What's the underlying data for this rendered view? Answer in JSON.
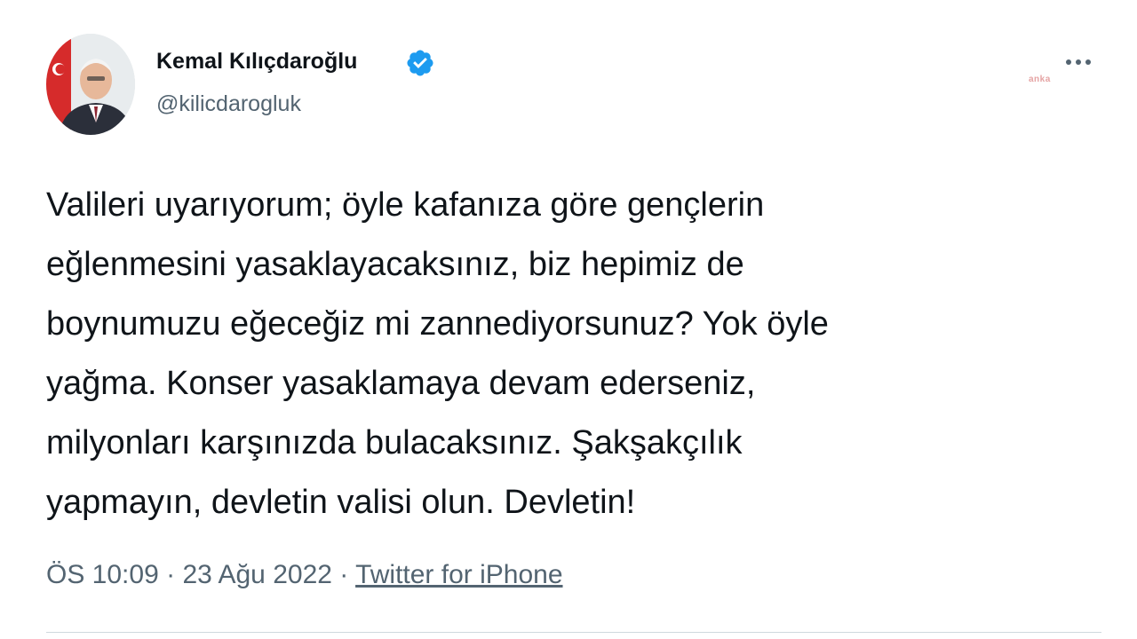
{
  "author": {
    "name": "Kemal Kılıçdaroğlu",
    "handle": "@kilicdarogluk",
    "verified": true,
    "avatar_icon": "profile-photo"
  },
  "watermark": "anka",
  "tweet": {
    "lines": [
      "Valileri uyarıyorum; öyle kafanıza göre gençlerin",
      "eğlenmesini yasaklayacaksınız, biz hepimiz de",
      "boynumuzu eğeceğiz mi zannediyorsunuz? Yok öyle",
      "yağma. Konser yasaklamaya devam ederseniz,",
      "milyonları karşınızda bulacaksınız. Şakşakçılık",
      "yapmayın, devletin valisi olun. Devletin!"
    ]
  },
  "meta": {
    "time": "ÖS 10:09",
    "separator": " · ",
    "date": "23 Ağu 2022",
    "source": "Twitter for iPhone"
  },
  "colors": {
    "verified": "#1d9bf0",
    "secondary_text": "#536471",
    "primary_text": "#0f1419"
  }
}
